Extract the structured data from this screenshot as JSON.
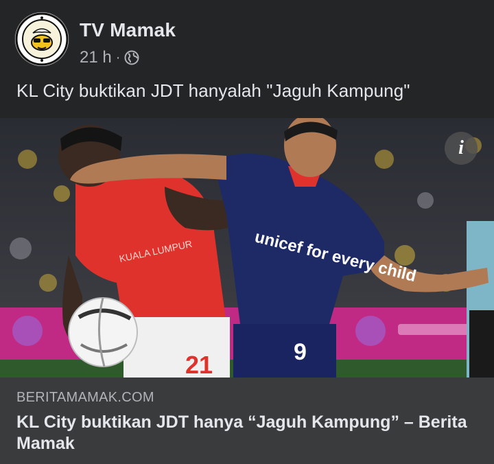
{
  "post": {
    "page_name": "TV Mamak",
    "timestamp": "21 h",
    "separator": "·",
    "privacy_icon": "globe-icon",
    "caption": "KL City buktikan JDT hanyalah \"Jaguh Kampung\""
  },
  "media": {
    "info_icon": "info-icon",
    "info_label": "i",
    "players": [
      {
        "team": "red",
        "shirt_number": "21",
        "shirt_text": "KUALA LUMPUR"
      },
      {
        "team": "blue",
        "shirt_number": "9",
        "shirt_text": "unicef for every child"
      }
    ]
  },
  "link_preview": {
    "domain": "BERITAMAMAK.COM",
    "title": "KL City buktikan JDT hanya “Jaguh Kampung” – Berita Mamak"
  },
  "colors": {
    "background": "#242526",
    "link_box": "#3a3b3c",
    "primary_text": "#e4e6eb",
    "secondary_text": "#b0b3b8",
    "red_kit": "#e0322c",
    "blue_kit": "#1e2a66"
  }
}
